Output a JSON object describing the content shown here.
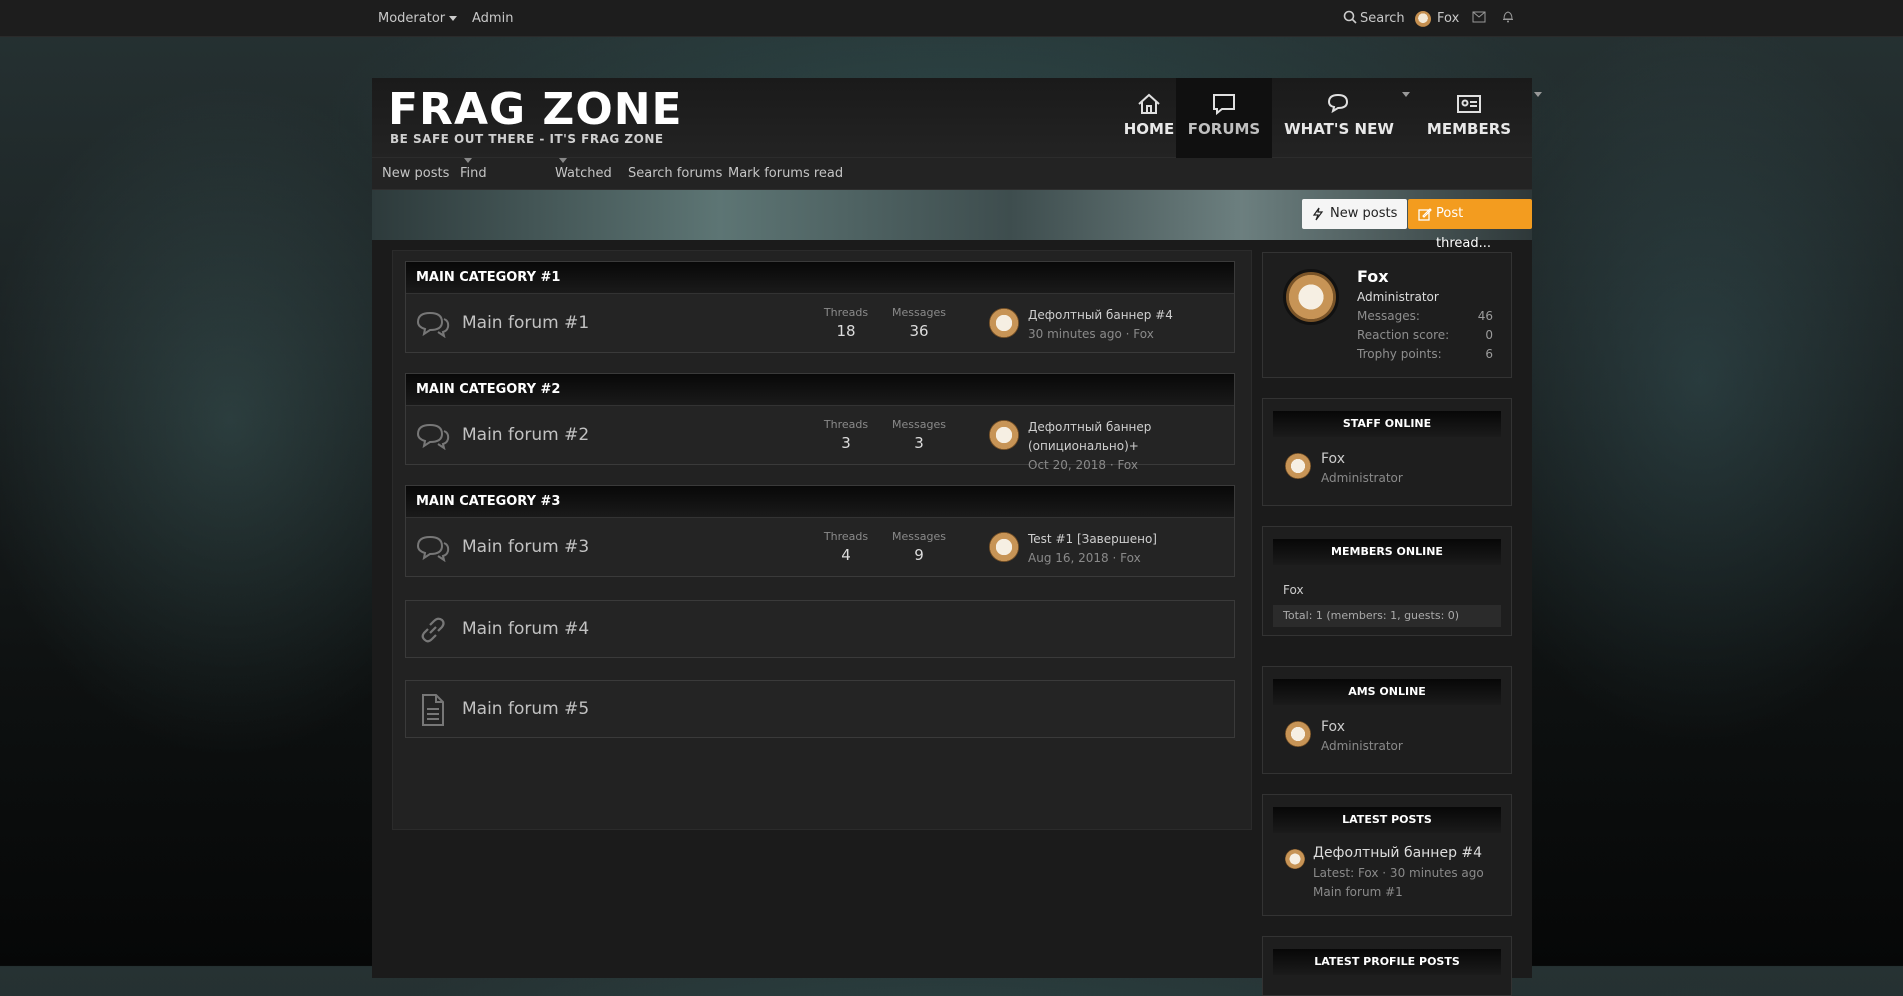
{
  "topbar": {
    "moderator": "Moderator",
    "admin": "Admin",
    "search": "Search",
    "user": "Fox"
  },
  "header": {
    "logo": "FRAG ZONE",
    "tagline": "BE SAFE OUT THERE - IT'S FRAG ZONE"
  },
  "nav": [
    {
      "label": "HOME",
      "icon": "home-icon"
    },
    {
      "label": "FORUMS",
      "icon": "forums-icon"
    },
    {
      "label": "WHAT'S NEW",
      "icon": "chat-icon"
    },
    {
      "label": "MEMBERS",
      "icon": "id-card-icon"
    }
  ],
  "subnav": {
    "new_posts": "New posts",
    "find_threads": "Find threads",
    "watched": "Watched",
    "search_forums": "Search forums",
    "mark_read": "Mark forums read"
  },
  "actions": {
    "new_posts": "New posts",
    "post_thread": "Post thread..."
  },
  "categories": [
    {
      "title": "MAIN CATEGORY #1",
      "forum": "Main forum #1",
      "threads_label": "Threads",
      "threads": "18",
      "messages_label": "Messages",
      "messages": "36",
      "last_title": "Дефолтный баннер #4",
      "last_time": "30 minutes ago",
      "last_user": "Fox"
    },
    {
      "title": "MAIN CATEGORY #2",
      "forum": "Main forum #2",
      "threads_label": "Threads",
      "threads": "3",
      "messages_label": "Messages",
      "messages": "3",
      "last_title": "Дефолтный баннер (опиционально)+",
      "last_time": "Oct 20, 2018",
      "last_user": "Fox"
    },
    {
      "title": "MAIN CATEGORY #3",
      "forum": "Main forum #3",
      "threads_label": "Threads",
      "threads": "4",
      "messages_label": "Messages",
      "messages": "9",
      "last_title": "Test #1 [Завершено]",
      "last_time": "Aug 16, 2018",
      "last_user": "Fox"
    }
  ],
  "link_forum": "Main forum #4",
  "page_forum": "Main forum #5",
  "profile": {
    "name": "Fox",
    "role": "Administrator",
    "messages_label": "Messages:",
    "messages": "46",
    "reaction_label": "Reaction score:",
    "reaction": "0",
    "trophy_label": "Trophy points:",
    "trophy": "6"
  },
  "staff_online": {
    "title": "STAFF ONLINE",
    "name": "Fox",
    "role": "Administrator"
  },
  "members_online": {
    "title": "MEMBERS ONLINE",
    "name": "Fox",
    "total": "Total: 1 (members: 1, guests: 0)"
  },
  "ams_online": {
    "title": "AMS ONLINE",
    "name": "Fox",
    "role": "Administrator"
  },
  "latest_posts": {
    "title": "LATEST POSTS",
    "post": "Дефолтный баннер #4",
    "meta": "Latest: Fox · 30 minutes ago",
    "forum": "Main forum #1"
  },
  "latest_profile_posts": {
    "title": "LATEST PROFILE POSTS"
  },
  "colors": {
    "accent": "#f39c1f",
    "panel": "#1e1e1e",
    "header": "#080808"
  }
}
